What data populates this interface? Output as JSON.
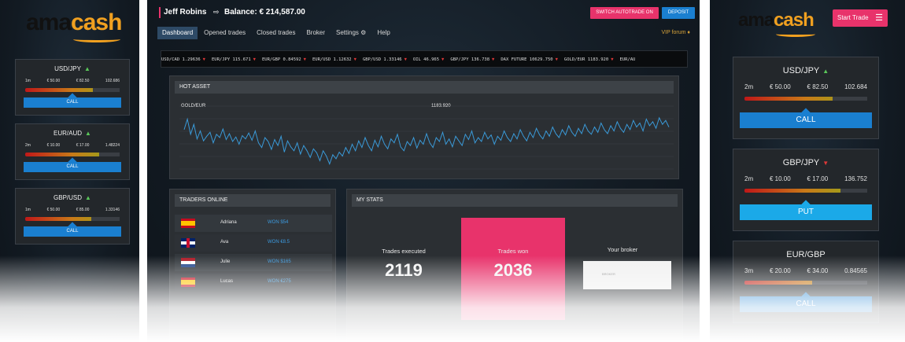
{
  "logo": {
    "ama": "ama",
    "cash": "cash"
  },
  "left_widgets": [
    {
      "pair": "USD/JPY",
      "dir": "up",
      "time": "1m",
      "low": "€ 50.00",
      "high": "€ 82.50",
      "rate": "102.686",
      "button": "CALL",
      "button_type": "call",
      "fill": 0.72
    },
    {
      "pair": "EUR/AUD",
      "dir": "up",
      "time": "2m",
      "low": "€ 10.00",
      "high": "€ 17.00",
      "rate": "1.48224",
      "button": "CALL",
      "button_type": "call",
      "fill": 0.78
    },
    {
      "pair": "GBP/USD",
      "dir": "up",
      "time": "1m",
      "low": "€ 50.00",
      "high": "€ 85.00",
      "rate": "1.33146",
      "button": "CALL",
      "button_type": "call",
      "fill": 0.7
    }
  ],
  "header": {
    "user_name": "Jeff Robins",
    "balance": "Balance: € 214,587.00",
    "autotrade_button": "SWITCH AUTOTRADE ON",
    "deposit_button": "DEPOSIT"
  },
  "nav": {
    "tabs": [
      "Dashboard",
      "Opened trades",
      "Closed trades",
      "Broker",
      "Settings",
      "Help"
    ],
    "vip": "VIP forum"
  },
  "ticker": [
    {
      "text": "USD/CAD 1.29636"
    },
    {
      "text": "EUR/JPY 115.671"
    },
    {
      "text": "EUR/GBP 0.84592"
    },
    {
      "text": "EUR/USD 1.12632"
    },
    {
      "text": "GBP/USD 1.33146"
    },
    {
      "text": "OIL 46.965"
    },
    {
      "text": "GBP/JPY 136.738"
    },
    {
      "text": "DAX FUTURE 10629.750"
    },
    {
      "text": "GOLD/EUR 1183.920"
    },
    {
      "text": "EUR/AU"
    }
  ],
  "hot_asset": {
    "title": "HOT ASSET",
    "asset": "GOLD/EUR",
    "price": "1183.920"
  },
  "chart_data": {
    "type": "line",
    "series": [
      {
        "values": [
          0.62,
          0.78,
          0.55,
          0.7,
          0.48,
          0.6,
          0.45,
          0.52,
          0.58,
          0.42,
          0.55,
          0.5,
          0.63,
          0.47,
          0.56,
          0.44,
          0.51,
          0.4,
          0.53,
          0.48,
          0.57,
          0.46,
          0.6,
          0.42,
          0.35,
          0.5,
          0.44,
          0.32,
          0.47,
          0.38,
          0.52,
          0.28,
          0.45,
          0.36,
          0.3,
          0.42,
          0.25,
          0.38,
          0.3,
          0.2,
          0.33,
          0.27,
          0.15,
          0.3,
          0.22,
          0.1,
          0.24,
          0.18,
          0.28,
          0.22,
          0.35,
          0.26,
          0.4,
          0.3,
          0.45,
          0.35,
          0.5,
          0.38,
          0.3,
          0.46,
          0.36,
          0.52,
          0.4,
          0.33,
          0.48,
          0.42,
          0.55,
          0.36,
          0.3,
          0.44,
          0.38,
          0.5,
          0.34,
          0.46,
          0.4,
          0.56,
          0.42,
          0.35,
          0.5,
          0.44,
          0.58,
          0.4,
          0.48,
          0.36,
          0.52,
          0.45,
          0.38,
          0.55,
          0.47,
          0.6,
          0.42,
          0.5,
          0.44,
          0.58,
          0.48,
          0.54,
          0.4,
          0.52,
          0.46,
          0.6,
          0.5,
          0.44,
          0.56,
          0.48,
          0.62,
          0.52,
          0.45,
          0.58,
          0.5,
          0.64,
          0.54,
          0.48,
          0.6,
          0.52,
          0.66,
          0.56,
          0.5,
          0.62,
          0.54,
          0.68,
          0.58,
          0.52,
          0.64,
          0.56,
          0.7,
          0.6,
          0.55,
          0.66,
          0.58,
          0.72,
          0.62,
          0.56,
          0.68,
          0.6,
          0.74,
          0.64,
          0.58,
          0.7,
          0.62,
          0.76,
          0.66,
          0.72,
          0.6,
          0.78,
          0.68,
          0.74,
          0.64,
          0.8,
          0.7,
          0.76,
          0.66
        ]
      }
    ]
  },
  "traders": {
    "title": "TRADERS ONLINE",
    "rows": [
      {
        "flag": "es",
        "name": "Adriana",
        "win": "WON $54"
      },
      {
        "flag": "uk",
        "name": "Ava",
        "win": "WON €8.5"
      },
      {
        "flag": "nl",
        "name": "Julie",
        "win": "WON $165"
      },
      {
        "flag": "es2",
        "name": "Lucas",
        "win": "WON €275"
      }
    ]
  },
  "stats": {
    "title": "MY STATS",
    "executed_label": "Trades executed",
    "executed_value": "2119",
    "won_label": "Trades won",
    "won_value": "2036",
    "broker_label": "Your broker",
    "broker_name": "BROKER"
  },
  "right_widgets": [
    {
      "pair": "USD/JPY",
      "dir": "up",
      "time": "2m",
      "low": "€ 50.00",
      "high": "€ 82.50",
      "rate": "102.684",
      "button": "CALL",
      "button_type": "call",
      "fill": 0.72
    },
    {
      "pair": "GBP/JPY",
      "dir": "down",
      "time": "2m",
      "low": "€ 10.00",
      "high": "€ 17.00",
      "rate": "136.752",
      "button": "PUT",
      "button_type": "put",
      "fill": 0.78
    },
    {
      "pair": "EUR/GBP",
      "dir": "none",
      "time": "3m",
      "low": "€ 20.00",
      "high": "€ 34.00",
      "rate": "0.84565",
      "button": "CALL",
      "button_type": "call",
      "fill": 0.55
    }
  ],
  "right_header": {
    "start_trade": "Start Trade"
  }
}
